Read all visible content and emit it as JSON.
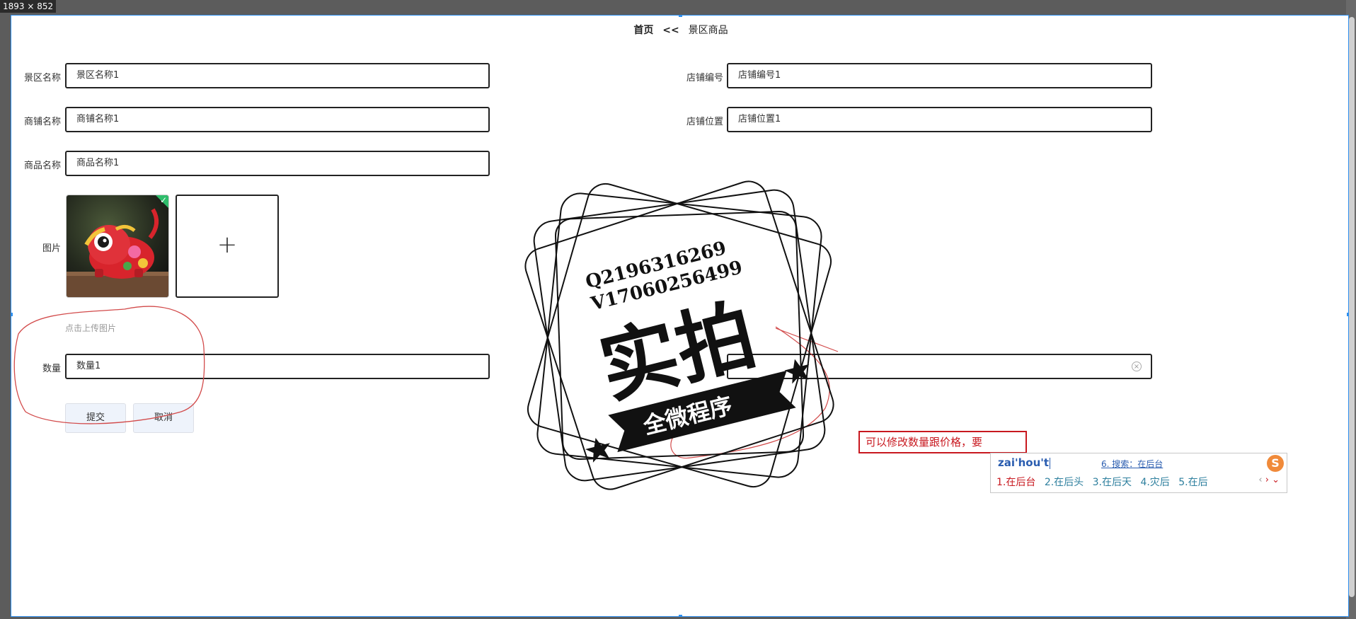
{
  "ruler": {
    "size_label": "1893 × 852"
  },
  "breadcrumb": {
    "home": "首页",
    "separator": "<<",
    "current": "景区商品"
  },
  "form": {
    "scenic_name": {
      "label": "景区名称",
      "value": "景区名称1"
    },
    "shop_no": {
      "label": "店铺编号",
      "value": "店铺编号1"
    },
    "merchant_name": {
      "label": "商铺名称",
      "value": "商铺名称1"
    },
    "shop_location": {
      "label": "店铺位置",
      "value": "店铺位置1"
    },
    "product_name": {
      "label": "商品名称",
      "value": "商品名称1"
    },
    "image": {
      "label": "图片",
      "upload_plus": "+",
      "hint": "点击上传图片"
    },
    "quantity": {
      "label": "数量",
      "value": "数量1"
    },
    "price_field": {
      "value": ""
    },
    "submit_label": "提交",
    "cancel_label": "取消"
  },
  "annotation": {
    "text": "可以修改数量跟价格，要"
  },
  "ime": {
    "pinyin": "zai'hou't",
    "search": "6. 搜索：在后台",
    "candidates": [
      "1.在后台",
      "2.在后头",
      "3.在后天",
      "4.灾后",
      "5.在后"
    ],
    "nav_prev": "‹",
    "nav_next": "›",
    "nav_expand": "⌄",
    "logo": "S"
  },
  "watermark": {
    "line1": "Q2196316269",
    "line2": "V17060256499",
    "main": "实拍",
    "ribbon": "全微程序"
  },
  "colors": {
    "accent": "#2d8ff0",
    "annotation_red": "#c8181f",
    "ime_blue": "#2a5db0",
    "button_bg": "#eef3fb"
  }
}
